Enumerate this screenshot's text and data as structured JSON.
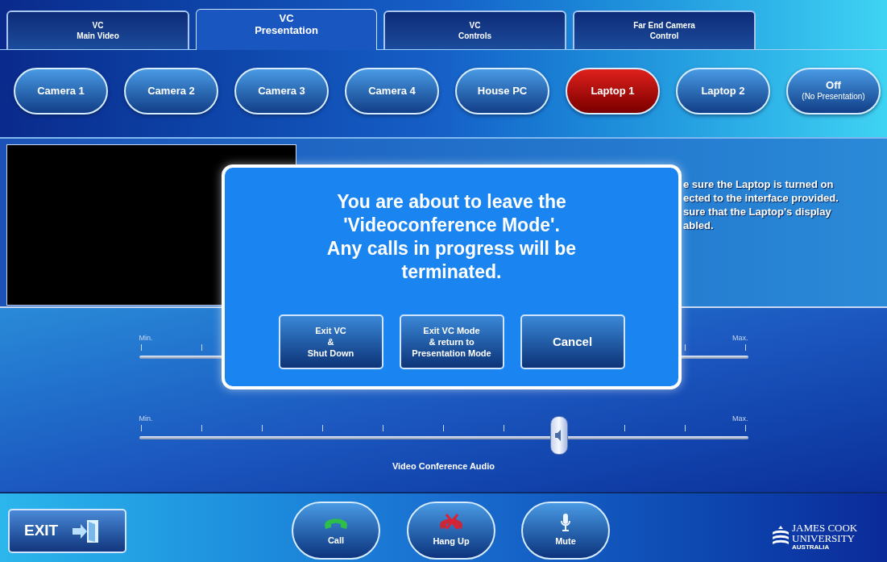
{
  "tabs": [
    {
      "lines": [
        "VC",
        "Main Video"
      ],
      "selected": false
    },
    {
      "lines": [
        "VC",
        "Presentation"
      ],
      "selected": true
    },
    {
      "lines": [
        "VC",
        "Controls"
      ],
      "selected": false
    },
    {
      "lines": [
        "Far End Camera",
        "Control"
      ],
      "selected": false
    }
  ],
  "sources": [
    {
      "label": "Camera 1",
      "selected": false
    },
    {
      "label": "Camera 2",
      "selected": false
    },
    {
      "label": "Camera 3",
      "selected": false
    },
    {
      "label": "Camera 4",
      "selected": false
    },
    {
      "label": "House PC",
      "selected": false
    },
    {
      "label": "Laptop 1",
      "selected": true
    },
    {
      "label": "Laptop 2",
      "selected": false
    },
    {
      "label": "Off",
      "sublabel": "(No Presentation)",
      "selected": false
    }
  ],
  "instructions": [
    "e sure the Laptop is turned on",
    "ected to the interface provided.",
    "sure that the Laptop's display",
    "abled."
  ],
  "sliders": [
    {
      "min": "Min.",
      "max": "Max."
    },
    {
      "min": "Min.",
      "max": "Max.",
      "level": 0.69,
      "label": "Video Conference Audio"
    }
  ],
  "dialog": {
    "message": [
      "You are about to leave the",
      "'Videoconference Mode'.",
      "Any calls in progress will be",
      "terminated."
    ],
    "buttons": [
      {
        "lines": [
          "Exit VC",
          "&",
          "Shut Down"
        ]
      },
      {
        "lines": [
          "Exit VC Mode",
          "& return to",
          "Presentation Mode"
        ]
      },
      {
        "lines": [
          "Cancel"
        ]
      }
    ]
  },
  "exit_button": {
    "label": "EXIT"
  },
  "call_controls": [
    {
      "label": "Call",
      "kind": "call"
    },
    {
      "label": "Hang Up",
      "kind": "hangup"
    },
    {
      "label": "Mute",
      "kind": "mute"
    }
  ],
  "logo": {
    "lines": [
      "JAMES COOK",
      "UNIVERSITY",
      "AUSTRALIA"
    ]
  }
}
